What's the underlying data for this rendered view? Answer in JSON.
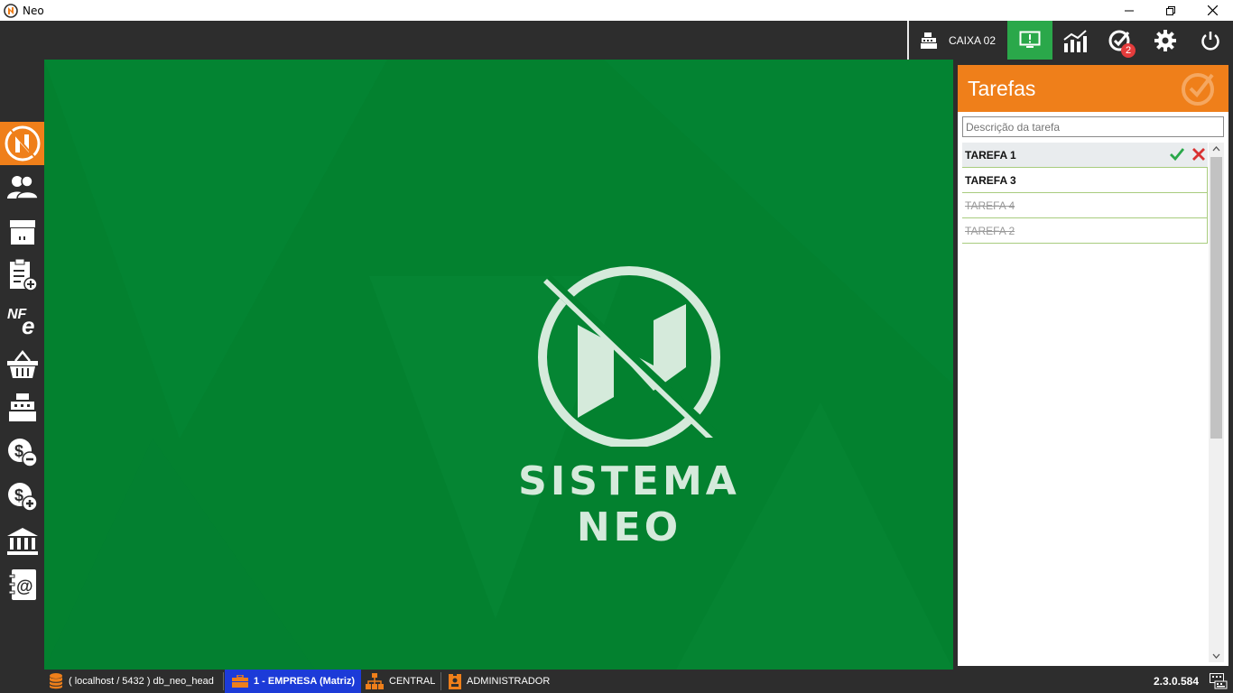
{
  "window": {
    "title": "Neo"
  },
  "toolbar": {
    "caixa_label": "CAIXA 02",
    "tasks_badge": "2"
  },
  "sidebar": {
    "items": [
      {
        "name": "home",
        "icon": "neo-logo-icon"
      },
      {
        "name": "clients",
        "icon": "users-icon"
      },
      {
        "name": "products",
        "icon": "box-icon"
      },
      {
        "name": "orders",
        "icon": "clipboard-add-icon"
      },
      {
        "name": "nfe",
        "icon": "nfe-icon"
      },
      {
        "name": "purchases",
        "icon": "basket-icon"
      },
      {
        "name": "cash-register",
        "icon": "cash-register-icon"
      },
      {
        "name": "payables",
        "icon": "money-minus-icon"
      },
      {
        "name": "receivables",
        "icon": "money-plus-icon"
      },
      {
        "name": "bank",
        "icon": "bank-icon"
      },
      {
        "name": "contacts",
        "icon": "address-book-icon"
      }
    ]
  },
  "main": {
    "brand": "SISTEMA NEO"
  },
  "tasks_panel": {
    "title": "Tarefas",
    "input_placeholder": "Descrição da tarefa",
    "tasks": [
      {
        "label": "TAREFA 1",
        "status": "selected"
      },
      {
        "label": "TAREFA 3",
        "status": "pending"
      },
      {
        "label": "TAREFA 4",
        "status": "done"
      },
      {
        "label": "TAREFA 2",
        "status": "done"
      }
    ]
  },
  "statusbar": {
    "database": "( localhost / 5432 ) db_neo_head",
    "company": "1 - EMPRESA (Matriz)",
    "branch": "CENTRAL",
    "user": "ADMINISTRADOR",
    "version": "2.3.0.584"
  },
  "colors": {
    "accent_orange": "#ef7f1a",
    "main_green": "#03812f",
    "active_green": "#2aa84a",
    "company_blue": "#1c3bd8",
    "dark": "#2d2d2d"
  }
}
